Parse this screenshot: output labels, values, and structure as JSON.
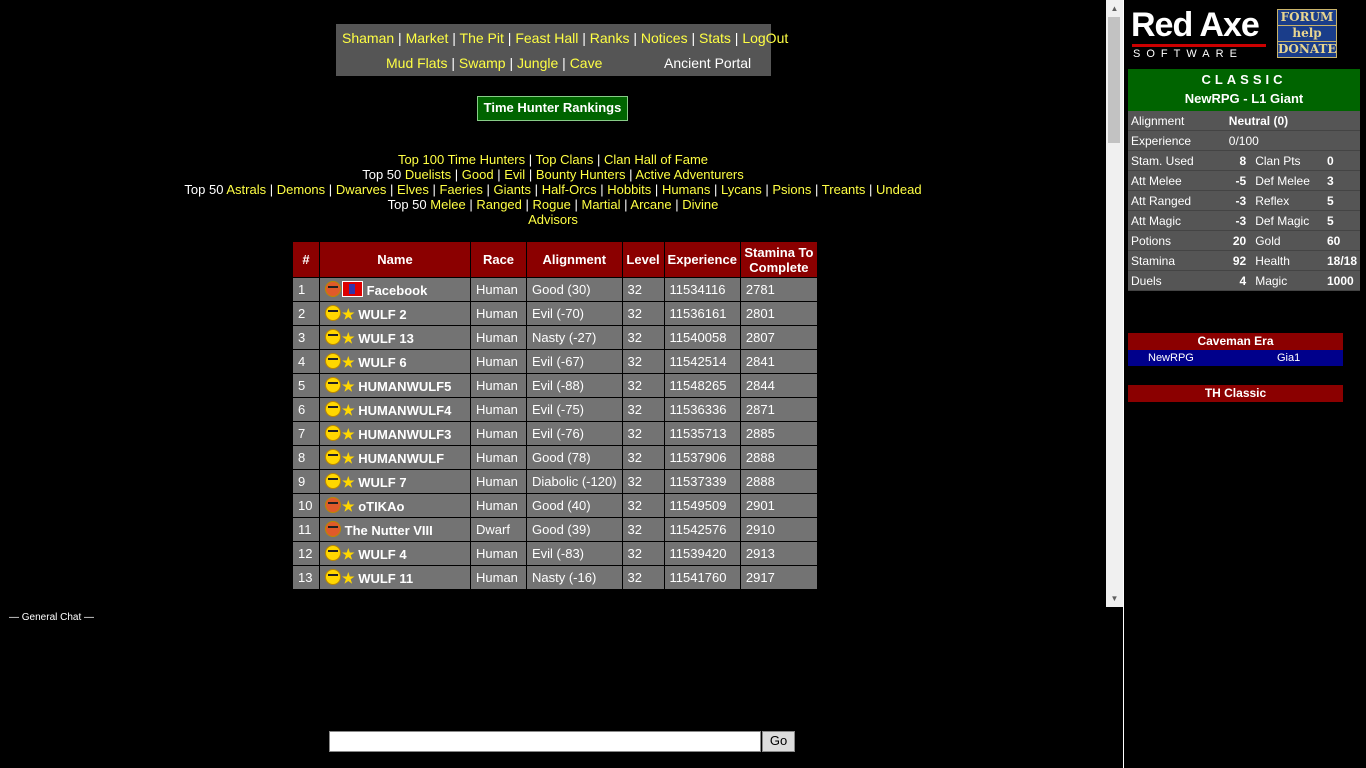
{
  "nav": {
    "row1": [
      "Shaman",
      "Market",
      "The Pit",
      "Feast Hall",
      "Ranks",
      "Notices",
      "Stats",
      "LogOut"
    ],
    "row2": [
      "Mud Flats",
      "Swamp",
      "Jungle",
      "Cave"
    ],
    "portal": "Ancient Portal",
    "separator": "|"
  },
  "rankings_button": "Time Hunter Rankings",
  "top_links": {
    "line1": [
      "Top 100 Time Hunters",
      "Top Clans",
      "Clan Hall of Fame"
    ],
    "line2_prefix": "Top 50",
    "line2": [
      "Duelists",
      "Good",
      "Evil",
      "Bounty Hunters",
      "Active Adventurers"
    ],
    "line3_prefix": "Top 50",
    "line3": [
      "Astrals",
      "Demons",
      "Dwarves",
      "Elves",
      "Faeries",
      "Giants",
      "Half-Orcs",
      "Hobbits",
      "Humans",
      "Lycans",
      "Psions",
      "Treants",
      "Undead"
    ],
    "line4_prefix": "Top 50",
    "line4": [
      "Melee",
      "Ranged",
      "Rogue",
      "Martial",
      "Arcane",
      "Divine"
    ],
    "line5": "Advisors"
  },
  "table": {
    "headers": [
      "#",
      "Name",
      "Race",
      "Alignment",
      "Level",
      "Experience",
      "Stamina To Complete"
    ],
    "rows": [
      {
        "rank": "1",
        "name": "Facebook",
        "race": "Human",
        "alignment": "Good (30)",
        "level": "32",
        "exp": "11534116",
        "stamina": "2781",
        "face": "red",
        "badge": "flag"
      },
      {
        "rank": "2",
        "name": "WULF 2",
        "race": "Human",
        "alignment": "Evil (-70)",
        "level": "32",
        "exp": "11536161",
        "stamina": "2801",
        "face": "yellow",
        "badge": "star"
      },
      {
        "rank": "3",
        "name": "WULF 13",
        "race": "Human",
        "alignment": "Nasty (-27)",
        "level": "32",
        "exp": "11540058",
        "stamina": "2807",
        "face": "yellow",
        "badge": "star"
      },
      {
        "rank": "4",
        "name": "WULF 6",
        "race": "Human",
        "alignment": "Evil (-67)",
        "level": "32",
        "exp": "11542514",
        "stamina": "2841",
        "face": "yellow",
        "badge": "star"
      },
      {
        "rank": "5",
        "name": "HUMANWULF5",
        "race": "Human",
        "alignment": "Evil (-88)",
        "level": "32",
        "exp": "11548265",
        "stamina": "2844",
        "face": "yellow",
        "badge": "star"
      },
      {
        "rank": "6",
        "name": "HUMANWULF4",
        "race": "Human",
        "alignment": "Evil (-75)",
        "level": "32",
        "exp": "11536336",
        "stamina": "2871",
        "face": "yellow",
        "badge": "star"
      },
      {
        "rank": "7",
        "name": "HUMANWULF3",
        "race": "Human",
        "alignment": "Evil (-76)",
        "level": "32",
        "exp": "11535713",
        "stamina": "2885",
        "face": "yellow",
        "badge": "star"
      },
      {
        "rank": "8",
        "name": "HUMANWULF",
        "race": "Human",
        "alignment": "Good (78)",
        "level": "32",
        "exp": "11537906",
        "stamina": "2888",
        "face": "yellow",
        "badge": "star"
      },
      {
        "rank": "9",
        "name": "WULF 7",
        "race": "Human",
        "alignment": "Diabolic (-120)",
        "level": "32",
        "exp": "11537339",
        "stamina": "2888",
        "face": "yellow",
        "badge": "star"
      },
      {
        "rank": "10",
        "name": "oTIKAo",
        "race": "Human",
        "alignment": "Good (40)",
        "level": "32",
        "exp": "11549509",
        "stamina": "2901",
        "face": "red",
        "badge": "star"
      },
      {
        "rank": "11",
        "name": "The Nutter VIII",
        "race": "Dwarf",
        "alignment": "Good (39)",
        "level": "32",
        "exp": "11542576",
        "stamina": "2910",
        "face": "red",
        "badge": "none"
      },
      {
        "rank": "12",
        "name": "WULF 4",
        "race": "Human",
        "alignment": "Evil (-83)",
        "level": "32",
        "exp": "11539420",
        "stamina": "2913",
        "face": "yellow",
        "badge": "star"
      },
      {
        "rank": "13",
        "name": "WULF 11",
        "race": "Human",
        "alignment": "Nasty (-16)",
        "level": "32",
        "exp": "11541760",
        "stamina": "2917",
        "face": "yellow",
        "badge": "star"
      }
    ]
  },
  "chat": {
    "label": "— General Chat —",
    "input_value": "",
    "go_label": "Go"
  },
  "sidebar": {
    "logo_big": "Red Axe",
    "logo_small": "SOFTWARE",
    "buttons": [
      "FORUM",
      "help",
      "DONATE"
    ],
    "mode": "CLASSIC",
    "character": "NewRPG - L1 Giant",
    "alignment_label": "Alignment",
    "alignment_value": "Neutral (0)",
    "experience_label": "Experience",
    "experience_value": "0/100",
    "stats": [
      {
        "l1": "Stam. Used",
        "v1": "8",
        "l2": "Clan Pts",
        "v2": "0"
      },
      {
        "l1": "Att Melee",
        "v1": "-5",
        "l2": "Def Melee",
        "v2": "3"
      },
      {
        "l1": "Att Ranged",
        "v1": "-3",
        "l2": "Reflex",
        "v2": "5"
      },
      {
        "l1": "Att Magic",
        "v1": "-3",
        "l2": "Def Magic",
        "v2": "5"
      },
      {
        "l1": "Potions",
        "v1": "20",
        "l2": "Gold",
        "v2": "60"
      },
      {
        "l1": "Stamina",
        "v1": "92",
        "l2": "Health",
        "v2": "18/18"
      },
      {
        "l1": "Duels",
        "v1": "4",
        "l2": "Magic",
        "v2": "1000"
      }
    ],
    "era_title": "Caveman Era",
    "era_name": "NewRPG",
    "era_value": "Gia1",
    "th_classic": "TH Classic"
  },
  "colors": {
    "link": "#ffff44",
    "header_red": "#8b0000",
    "panel_green": "#006400",
    "cell_grey": "#737373"
  }
}
